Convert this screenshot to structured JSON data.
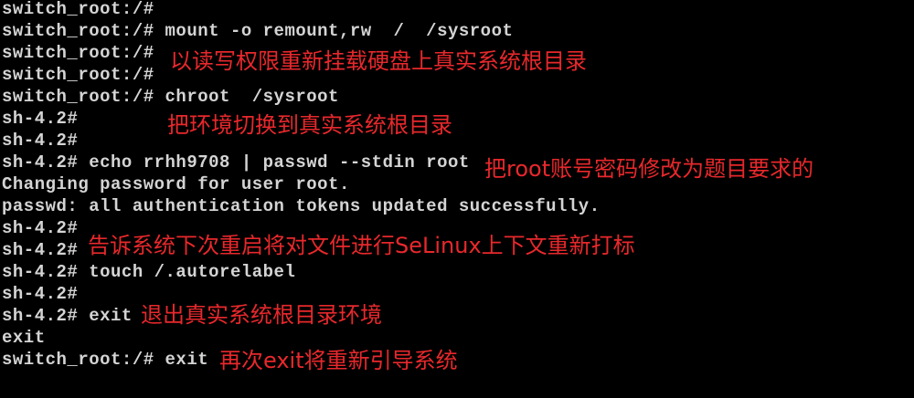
{
  "terminal": {
    "lines": [
      "switch_root:/#",
      "switch_root:/# mount -o remount,rw  /  /sysroot",
      "switch_root:/#",
      "switch_root:/#",
      "switch_root:/# chroot  /sysroot",
      "sh-4.2#",
      "sh-4.2#",
      "sh-4.2# echo rrhh9708 | passwd --stdin root",
      "Changing password for user root.",
      "passwd: all authentication tokens updated successfully.",
      "sh-4.2#",
      "sh-4.2#",
      "sh-4.2# touch /.autorelabel",
      "sh-4.2#",
      "sh-4.2# exit",
      "exit",
      "switch_root:/# exit"
    ]
  },
  "annotations": {
    "remount": "以读写权限重新挂载硬盘上真实系统根目录",
    "chroot": "把环境切换到真实系统根目录",
    "passwd": "把root账号密码修改为题目要求的",
    "autorelabel": "告诉系统下次重启将对文件进行SeLinux上下文重新打标",
    "exit_chroot": "退出真实系统根目录环境",
    "exit_reboot": "再次exit将重新引导系统"
  },
  "colors": {
    "background": "#000000",
    "terminal_text": "#d4d4d4",
    "annotation_text": "#e8282c"
  }
}
